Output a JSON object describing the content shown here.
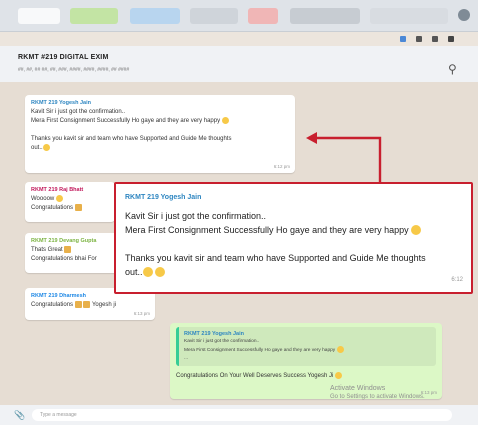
{
  "header": {
    "title": "RKMT #219 DIGITAL EXIM",
    "subtitle": "##, ##, ## ##, ##, ###, ####, ####, ####, ## ####"
  },
  "messages": [
    {
      "sender": "RKMT 219 Yogesh Jain",
      "sender_color": "#2e86c1",
      "text1": "Kavit Sir i just got the confirmation..",
      "text2": "Mera First Consignment Successfully Ho gaye and they are very happy",
      "text3": "Thanks you kavit sir and team who have Supported and Guide Me thoughts",
      "text4": "out..",
      "time": "6:12 pm"
    },
    {
      "sender": "RKMT 219 Raj Bhatt",
      "sender_color": "#c2185b",
      "text1": "Woooow",
      "text2": "Congratulations"
    },
    {
      "sender": "RKMT 219 Devang Gupta",
      "sender_color": "#7cb342",
      "text1": "Thats Great",
      "text2": "Congratulations bhai For"
    },
    {
      "sender": "RKMT 219 Dharmesh",
      "sender_color": "#1e88e5",
      "text1": "Congratulations",
      "text2": "Yogesh ji",
      "time": "6:13 pm"
    }
  ],
  "outgoing": {
    "quote_sender": "RKMT 219 Yogesh Jain",
    "quote_text1": "Kavit Sir i just got the confirmation..",
    "quote_text2": "Mera First Consignment Successfully Ho gaye and they are very happy",
    "quote_text3": "...",
    "text": "Congratulations On Your Well Deserves Success Yogesh Ji",
    "time": "6:13 pm"
  },
  "zoom": {
    "sender": "RKMT 219 Yogesh Jain",
    "line1": "Kavit Sir i just got the confirmation..",
    "line2": "Mera First Consignment Successfully Ho gaye and they are very happy",
    "line3": "Thanks you kavit sir and team who have Supported and Guide Me thoughts",
    "line4": "out..",
    "time": "6:12"
  },
  "input": {
    "placeholder": "Type a message"
  },
  "watermark": {
    "line1": "Activate Windows",
    "line2": "Go to Settings to activate Windows."
  },
  "colors": {
    "highlight": "#c81f2e",
    "chat_bg": "#e6ddd3",
    "outgoing_bg": "#dcf8c6"
  }
}
